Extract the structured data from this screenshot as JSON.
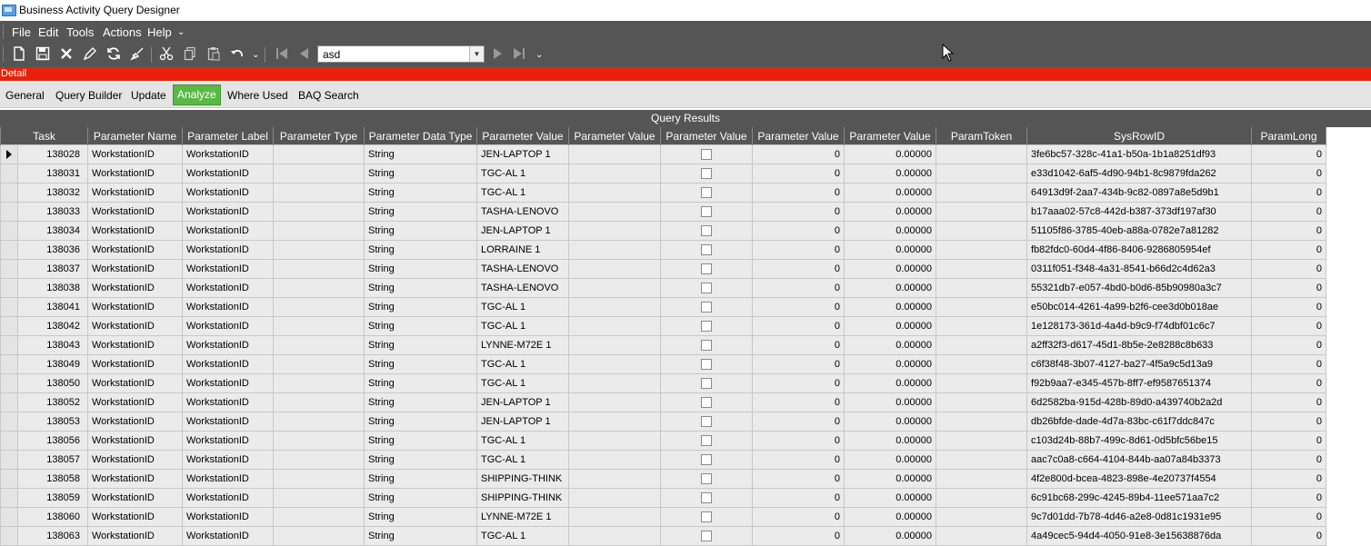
{
  "window": {
    "title": "Business Activity Query Designer"
  },
  "menu": {
    "items": [
      "File",
      "Edit",
      "Tools",
      "Actions",
      "Help"
    ]
  },
  "toolbar": {
    "icons": [
      "new-icon",
      "save-icon",
      "delete-icon",
      "edit-icon",
      "refresh-icon",
      "clear-icon",
      "cut-icon",
      "copy-icon",
      "paste-icon",
      "undo-icon",
      "first-record-icon",
      "previous-record-icon",
      "next-record-icon",
      "last-record-icon"
    ],
    "query_id_value": "asd"
  },
  "detail_label": "Detail",
  "tabs": [
    {
      "label": "General",
      "active": false
    },
    {
      "label": "Query Builder",
      "active": false
    },
    {
      "label": "Update",
      "active": false
    },
    {
      "label": "Analyze",
      "active": true
    },
    {
      "label": "Where Used",
      "active": false
    },
    {
      "label": "BAQ Search",
      "active": false
    }
  ],
  "results": {
    "title": "Query Results",
    "columns": [
      "Task",
      "Parameter Name",
      "Parameter Label",
      "Parameter Type",
      "Parameter Data Type",
      "Parameter Value",
      "Parameter Value",
      "Parameter Value",
      "Parameter Value",
      "Parameter Value",
      "ParamToken",
      "SysRowID",
      "ParamLong"
    ],
    "rows": [
      [
        "138028",
        "WorkstationID",
        "WorkstationID",
        "",
        "String",
        "JEN-LAPTOP 1",
        "",
        false,
        "0",
        "0.00000",
        "",
        "3fe6bc57-328c-41a1-b50a-1b1a8251df93",
        "0"
      ],
      [
        "138031",
        "WorkstationID",
        "WorkstationID",
        "",
        "String",
        "TGC-AL 1",
        "",
        false,
        "0",
        "0.00000",
        "",
        "e33d1042-6af5-4d90-94b1-8c9879fda262",
        "0"
      ],
      [
        "138032",
        "WorkstationID",
        "WorkstationID",
        "",
        "String",
        "TGC-AL 1",
        "",
        false,
        "0",
        "0.00000",
        "",
        "64913d9f-2aa7-434b-9c82-0897a8e5d9b1",
        "0"
      ],
      [
        "138033",
        "WorkstationID",
        "WorkstationID",
        "",
        "String",
        "TASHA-LENOVO",
        "",
        false,
        "0",
        "0.00000",
        "",
        "b17aaa02-57c8-442d-b387-373df197af30",
        "0"
      ],
      [
        "138034",
        "WorkstationID",
        "WorkstationID",
        "",
        "String",
        "JEN-LAPTOP 1",
        "",
        false,
        "0",
        "0.00000",
        "",
        "51105f86-3785-40eb-a88a-0782e7a81282",
        "0"
      ],
      [
        "138036",
        "WorkstationID",
        "WorkstationID",
        "",
        "String",
        "LORRAINE 1",
        "",
        false,
        "0",
        "0.00000",
        "",
        "fb82fdc0-60d4-4f86-8406-9286805954ef",
        "0"
      ],
      [
        "138037",
        "WorkstationID",
        "WorkstationID",
        "",
        "String",
        "TASHA-LENOVO",
        "",
        false,
        "0",
        "0.00000",
        "",
        "0311f051-f348-4a31-8541-b66d2c4d62a3",
        "0"
      ],
      [
        "138038",
        "WorkstationID",
        "WorkstationID",
        "",
        "String",
        "TASHA-LENOVO",
        "",
        false,
        "0",
        "0.00000",
        "",
        "55321db7-e057-4bd0-b0d6-85b90980a3c7",
        "0"
      ],
      [
        "138041",
        "WorkstationID",
        "WorkstationID",
        "",
        "String",
        "TGC-AL 1",
        "",
        false,
        "0",
        "0.00000",
        "",
        "e50bc014-4261-4a99-b2f6-cee3d0b018ae",
        "0"
      ],
      [
        "138042",
        "WorkstationID",
        "WorkstationID",
        "",
        "String",
        "TGC-AL 1",
        "",
        false,
        "0",
        "0.00000",
        "",
        "1e128173-361d-4a4d-b9c9-f74dbf01c6c7",
        "0"
      ],
      [
        "138043",
        "WorkstationID",
        "WorkstationID",
        "",
        "String",
        "LYNNE-M72E 1",
        "",
        false,
        "0",
        "0.00000",
        "",
        "a2ff32f3-d617-45d1-8b5e-2e8288c8b633",
        "0"
      ],
      [
        "138049",
        "WorkstationID",
        "WorkstationID",
        "",
        "String",
        "TGC-AL 1",
        "",
        false,
        "0",
        "0.00000",
        "",
        "c6f38f48-3b07-4127-ba27-4f5a9c5d13a9",
        "0"
      ],
      [
        "138050",
        "WorkstationID",
        "WorkstationID",
        "",
        "String",
        "TGC-AL 1",
        "",
        false,
        "0",
        "0.00000",
        "",
        "f92b9aa7-e345-457b-8ff7-ef9587651374",
        "0"
      ],
      [
        "138052",
        "WorkstationID",
        "WorkstationID",
        "",
        "String",
        "JEN-LAPTOP 1",
        "",
        false,
        "0",
        "0.00000",
        "",
        "6d2582ba-915d-428b-89d0-a439740b2a2d",
        "0"
      ],
      [
        "138053",
        "WorkstationID",
        "WorkstationID",
        "",
        "String",
        "JEN-LAPTOP 1",
        "",
        false,
        "0",
        "0.00000",
        "",
        "db26bfde-dade-4d7a-83bc-c61f7ddc847c",
        "0"
      ],
      [
        "138056",
        "WorkstationID",
        "WorkstationID",
        "",
        "String",
        "TGC-AL 1",
        "",
        false,
        "0",
        "0.00000",
        "",
        "c103d24b-88b7-499c-8d61-0d5bfc56be15",
        "0"
      ],
      [
        "138057",
        "WorkstationID",
        "WorkstationID",
        "",
        "String",
        "TGC-AL 1",
        "",
        false,
        "0",
        "0.00000",
        "",
        "aac7c0a8-c664-4104-844b-aa07a84b3373",
        "0"
      ],
      [
        "138058",
        "WorkstationID",
        "WorkstationID",
        "",
        "String",
        "SHIPPING-THINK",
        "",
        false,
        "0",
        "0.00000",
        "",
        "4f2e800d-bcea-4823-898e-4e20737f4554",
        "0"
      ],
      [
        "138059",
        "WorkstationID",
        "WorkstationID",
        "",
        "String",
        "SHIPPING-THINK",
        "",
        false,
        "0",
        "0.00000",
        "",
        "6c91bc68-299c-4245-89b4-11ee571aa7c2",
        "0"
      ],
      [
        "138060",
        "WorkstationID",
        "WorkstationID",
        "",
        "String",
        "LYNNE-M72E 1",
        "",
        false,
        "0",
        "0.00000",
        "",
        "9c7d01dd-7b78-4d46-a2e8-0d81c1931e95",
        "0"
      ],
      [
        "138063",
        "WorkstationID",
        "WorkstationID",
        "",
        "String",
        "TGC-AL 1",
        "",
        false,
        "0",
        "0.00000",
        "",
        "4a49cec5-94d4-4050-91e8-3e15638876da",
        "0"
      ]
    ]
  },
  "colors": {
    "accent_red": "#e8220a",
    "active_tab": "#5bb847",
    "dark_bar": "#555555"
  }
}
